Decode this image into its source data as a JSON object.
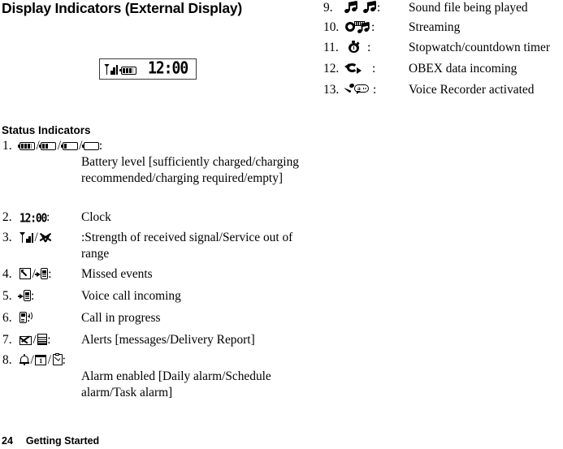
{
  "page": {
    "title": "Display Indicators (External Display)",
    "section_heading": "Status Indicators",
    "footer_page_number": "24",
    "footer_section": "Getting Started"
  },
  "external_display": {
    "signal_icon": "signal-bars-icon",
    "battery_icon": "battery-icon",
    "clock_text": "12:00"
  },
  "status_indicators": {
    "left_column": [
      {
        "number": "1.",
        "icons": [
          "battery-full-icon",
          "battery-two-thirds-icon",
          "battery-one-third-icon",
          "battery-empty-icon"
        ],
        "separator": "/",
        "colon": ":",
        "description": "Battery level [sufficiently charged/charging recommended/charging required/empty]"
      },
      {
        "number": "2.",
        "icons": [
          "lcd-clock-icon"
        ],
        "clock_text": "12:00",
        "colon": ":",
        "description": "Clock"
      },
      {
        "number": "3.",
        "icons": [
          "signal-bars-icon",
          "no-service-icon"
        ],
        "separator": "/",
        "colon": "",
        "description": ":Strength of received signal/Service out of range"
      },
      {
        "number": "4.",
        "icons": [
          "missed-call-icon",
          "incoming-event-icon"
        ],
        "separator": "/",
        "colon": ":",
        "description": "Missed events"
      },
      {
        "number": "5.",
        "icons": [
          "incoming-voice-call-icon"
        ],
        "colon": ":",
        "description": "Voice call incoming"
      },
      {
        "number": "6.",
        "icons": [
          "call-in-progress-icon"
        ],
        "colon": ":",
        "description": "Call in progress"
      },
      {
        "number": "7.",
        "icons": [
          "envelope-icon",
          "delivery-report-icon"
        ],
        "separator": "/",
        "colon": ":",
        "description": "Alerts [messages/Delivery Report]"
      },
      {
        "number": "8.",
        "icons": [
          "bell-icon",
          "calendar-icon",
          "task-checklist-icon"
        ],
        "separator": "/",
        "colon": ":",
        "description": "Alarm enabled [Daily alarm/Schedule alarm/Task alarm]"
      }
    ],
    "right_column": [
      {
        "number": "9.",
        "icons": [
          "music-note-icon",
          "music-note-icon"
        ],
        "colon": ":",
        "description": "Sound file being played"
      },
      {
        "number": "10.",
        "icons": [
          "streaming-icon"
        ],
        "colon": ":",
        "description": "Streaming"
      },
      {
        "number": "11.",
        "icons": [
          "stopwatch-icon"
        ],
        "colon": ":",
        "description": "Stopwatch/countdown timer"
      },
      {
        "number": "12.",
        "icons": [
          "obex-incoming-icon"
        ],
        "colon": ":",
        "description": "OBEX data incoming"
      },
      {
        "number": "13.",
        "icons": [
          "voice-recorder-icon"
        ],
        "colon": ":",
        "description": "Voice Recorder activated"
      }
    ]
  },
  "colors": {
    "text": "#000000",
    "background": "#ffffff",
    "display_border": "#3a3a3a"
  }
}
